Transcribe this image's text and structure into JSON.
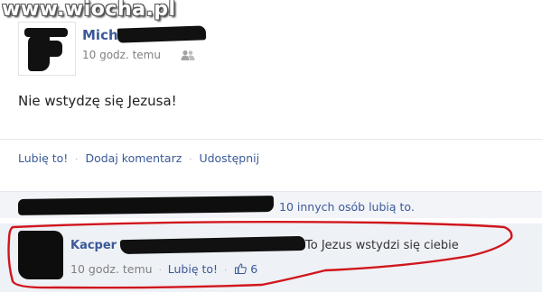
{
  "watermark": "www.wiocha.pl",
  "post": {
    "author": "Michał",
    "time": "10 godz. temu",
    "audience_icon": "friends-icon",
    "text": "Nie wstydzę się Jezusa!"
  },
  "actions": {
    "like": "Lubię to!",
    "comment": "Dodaj komentarz",
    "share": "Udostępnij",
    "separator": "·"
  },
  "likes": {
    "text": "10 innych osób lubią to."
  },
  "comment": {
    "author": "Kacper",
    "text": "To Jezus wstydzi się ciebie",
    "time": "10 godz. temu",
    "like": "Lubię to!",
    "like_count": "6",
    "separator": "·"
  },
  "colors": {
    "link": "#3b5998",
    "meta": "#808080",
    "highlight": "#d0161c",
    "comment_bg": "#eef1f6"
  }
}
